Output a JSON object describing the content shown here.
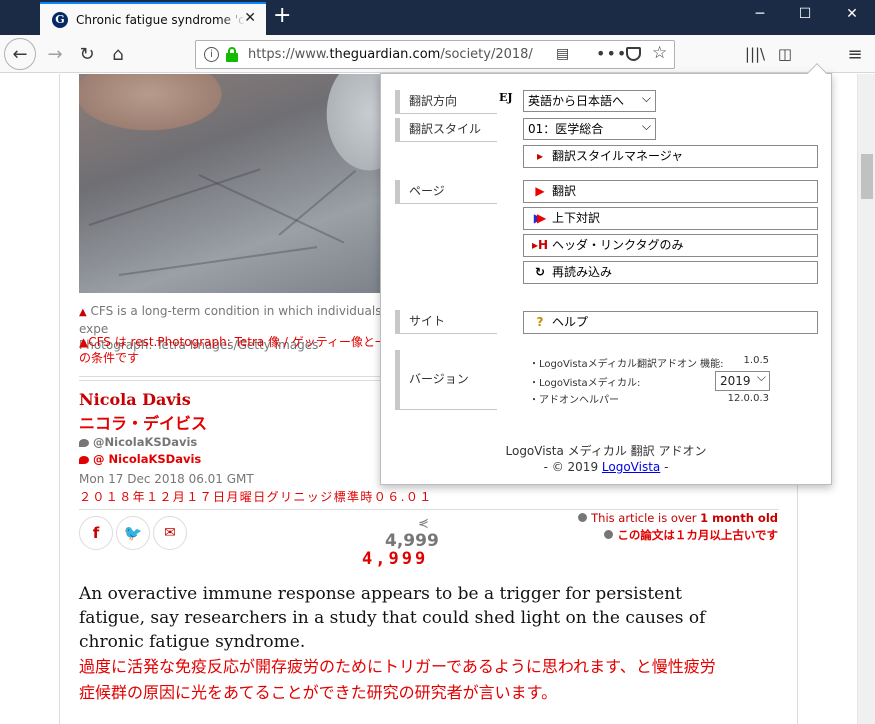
{
  "browser": {
    "tab_title": "Chronic fatigue syndrome 'cou",
    "tab_favicon_letter": "G",
    "url_host_prefix": "https://www.",
    "url_host": "theguardian.com",
    "url_path": "/society/2018/"
  },
  "article": {
    "caption_en": "CFS is a long-term condition in which individuals expe",
    "caption_credit": "Photograph: Tetra Images/Getty Images",
    "caption_ja_line1": "▲CFS は rest.Photograph: Tetra 像 / ゲッティー像と一緒",
    "caption_ja_line2": "の条件です",
    "author_en": "Nicola Davis",
    "author_ja": "ニコラ・デイビス",
    "twitter_en": "@NicolaKSDavis",
    "twitter_ja": "@ NicolaKSDavis",
    "date_en": "Mon 17 Dec 2018 06.01 GMT",
    "date_ja": "２０１８年１２月１７日月曜日グリニッジ標準時０６.０１",
    "share_count_en": "4,999",
    "share_count_ja": "4,999",
    "age_en_prefix": "This article is over ",
    "age_en_bold": "1 month old",
    "age_ja": "この論文は１カ月以上古いです",
    "standfirst_en": "An overactive immune response appears to be a trigger for persistent fatigue, say researchers in a study that could shed light on the causes of chronic fatigue syndrome.",
    "standfirst_ja": "過度に活発な免疫反応が開存疲労のためにトリガーであるように思われます、と慢性疲労症候群の原因に光をあてることができた研究の研究者が言います。"
  },
  "panel": {
    "direction_label": "翻訳方向",
    "direction_badge": "EJ",
    "direction_value": "英語から日本語へ",
    "style_label": "翻訳スタイル",
    "style_value": "01：医学総合",
    "style_manager_button": "翻訳スタイルマネージャ",
    "page_label": "ページ",
    "translate_button": "翻訳",
    "bilingual_button": "上下対訳",
    "header_only_button": "ヘッダ・リンクタグのみ",
    "reload_button": "再読み込み",
    "site_label": "サイト",
    "help_button": "ヘルプ",
    "version_label": "バージョン",
    "versions": [
      {
        "name": "・LogoVistaメディカル翻訳アドオン 機能:",
        "value": "1.0.5"
      },
      {
        "name": "・LogoVistaメディカル:",
        "value": "2019"
      },
      {
        "name": "・アドオンヘルパー",
        "value": "12.0.0.3"
      }
    ],
    "footer_title": "LogoVista メディカル 翻訳 アドオン",
    "footer_copyright_prefix": "- © 2019 ",
    "footer_link": "LogoVista",
    "footer_copyright_suffix": " -"
  }
}
